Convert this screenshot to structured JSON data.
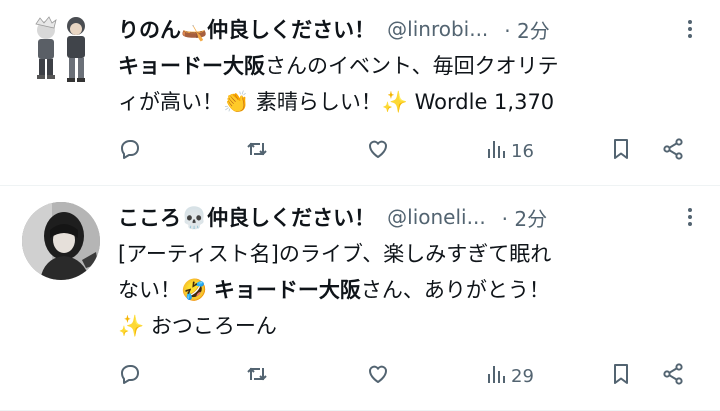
{
  "tweets": [
    {
      "name": "りのん🛶仲良しください！",
      "handle": "@linrobi...",
      "time": "· 2分",
      "text_line1_bold": "キョードー大阪",
      "text_line1": "さんのイベント、毎回クオリテ",
      "text_line2": "ィが高い！👏 素晴らしい！✨ Wordle 1,370",
      "views": "16"
    },
    {
      "name": "こころ💀仲良しください！",
      "handle": "@lioneli...",
      "time": "· 2分",
      "text_line1": "[アーティスト名]のライブ、楽しみすぎて眠れ",
      "text_line2a": "ない！🤣 ",
      "text_line2_bold": "キョードー大阪",
      "text_line2b": "さん、ありがとう！",
      "text_line3": "✨ おつころーん",
      "views": "29"
    }
  ],
  "icons": [
    "reply-icon",
    "retweet-icon",
    "like-icon",
    "views-icon",
    "bookmark-icon",
    "share-icon",
    "more-icon"
  ]
}
